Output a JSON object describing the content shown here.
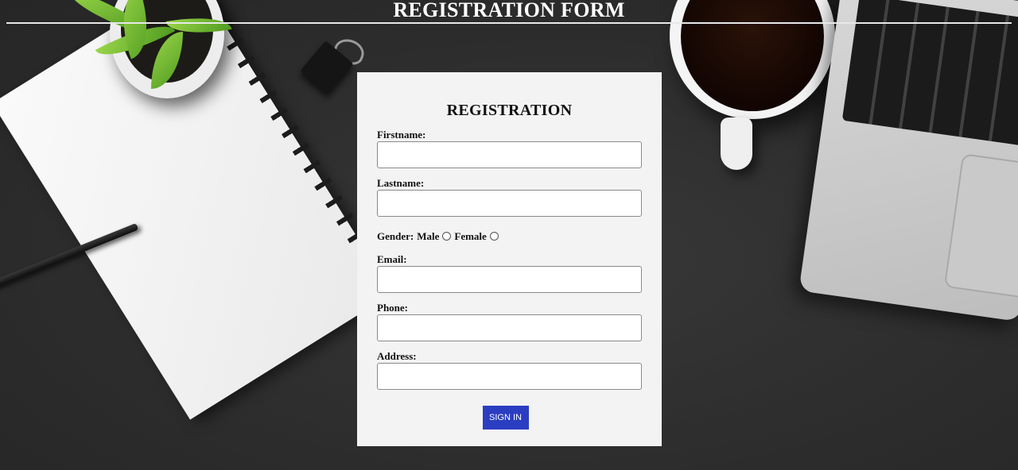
{
  "header": {
    "title": "REGISTRATION FORM"
  },
  "form": {
    "heading": "REGISTRATION",
    "firstname": {
      "label": "Firstname:",
      "value": ""
    },
    "lastname": {
      "label": "Lastname:",
      "value": ""
    },
    "gender": {
      "label": "Gender:",
      "options": [
        "Male",
        "Female"
      ],
      "selected": null
    },
    "email": {
      "label": "Email:",
      "value": ""
    },
    "phone": {
      "label": "Phone:",
      "value": ""
    },
    "address": {
      "label": "Address:",
      "value": ""
    },
    "submit_label": "SIGN IN"
  },
  "colors": {
    "header_text": "#ffffff",
    "card_background": "#f3f3f3",
    "button_background": "#2b3ec2",
    "button_text": "#ffffff"
  }
}
